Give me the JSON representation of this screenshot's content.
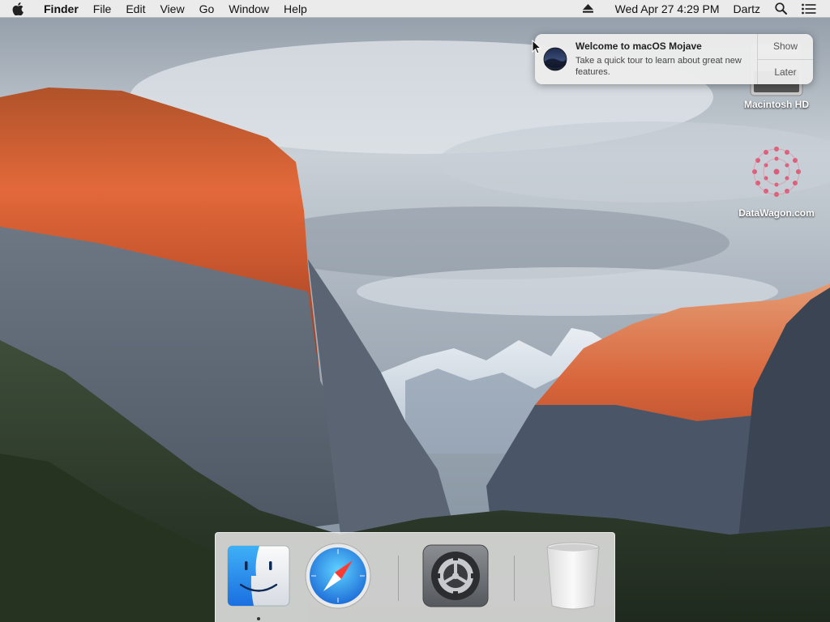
{
  "menubar": {
    "app_name": "Finder",
    "menus": [
      "File",
      "Edit",
      "View",
      "Go",
      "Window",
      "Help"
    ],
    "clock": "Wed Apr 27  4:29 PM",
    "user": "Dartz",
    "icons": [
      "apple-icon",
      "eject-icon",
      "spotlight-icon",
      "notification-center-icon"
    ]
  },
  "notification": {
    "title": "Welcome to macOS Mojave",
    "body": "Take a quick tour to learn about great new features.",
    "show_label": "Show",
    "later_label": "Later"
  },
  "desktop_icons": [
    {
      "label": "Macintosh HD",
      "icon": "hard-drive-icon"
    },
    {
      "label": "DataWagon.com",
      "icon": "datawagon-icon"
    }
  ],
  "dock": {
    "items": [
      {
        "name": "finder",
        "icon": "finder-icon",
        "running": true
      },
      {
        "name": "safari",
        "icon": "safari-icon",
        "running": false
      },
      {
        "name": "system-preferences",
        "icon": "system-preferences-icon",
        "running": false
      },
      {
        "name": "trash",
        "icon": "trash-icon",
        "running": false
      }
    ]
  },
  "colors": {
    "menubar_bg": "#eeeeee",
    "sky": "#9aa7b4",
    "cliff_orange": "#d9622a",
    "forest": "#2f3f2c"
  }
}
